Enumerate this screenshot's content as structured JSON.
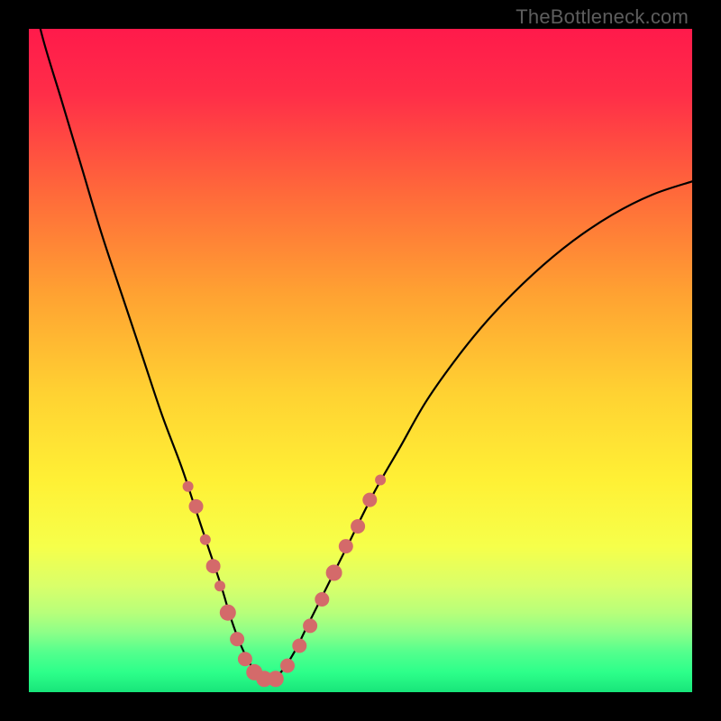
{
  "watermark": {
    "text": "TheBottleneck.com"
  },
  "colors": {
    "frame_bg": "#000000",
    "curve_stroke": "#000000",
    "marker_fill": "#d46a6a",
    "gradient_stops": [
      {
        "offset": 0,
        "color": "#ff1a4b"
      },
      {
        "offset": 10,
        "color": "#ff2e48"
      },
      {
        "offset": 25,
        "color": "#ff6a3a"
      },
      {
        "offset": 40,
        "color": "#ffa232"
      },
      {
        "offset": 55,
        "color": "#ffd232"
      },
      {
        "offset": 68,
        "color": "#fff035"
      },
      {
        "offset": 78,
        "color": "#f6ff4a"
      },
      {
        "offset": 84,
        "color": "#d9ff6a"
      },
      {
        "offset": 88,
        "color": "#b8ff7a"
      },
      {
        "offset": 91,
        "color": "#8dff88"
      },
      {
        "offset": 94,
        "color": "#53ff8d"
      },
      {
        "offset": 97,
        "color": "#2dff8a"
      },
      {
        "offset": 100,
        "color": "#18e57a"
      }
    ]
  },
  "chart_data": {
    "type": "line",
    "title": "",
    "xlabel": "",
    "ylabel": "",
    "xlim": [
      0,
      100
    ],
    "ylim": [
      0,
      100
    ],
    "grid": false,
    "legend": false,
    "series": [
      {
        "name": "v_curve",
        "x": [
          0,
          2,
          5,
          8,
          11,
          14,
          17,
          20,
          23,
          25,
          27,
          29,
          30.5,
          32,
          33.5,
          35,
          36.5,
          38,
          40,
          42,
          45,
          48,
          52,
          56,
          60,
          65,
          70,
          76,
          82,
          88,
          94,
          100
        ],
        "y": [
          108,
          99,
          89,
          79,
          69,
          60,
          51,
          42,
          34,
          28,
          22,
          16,
          11,
          7,
          4,
          2,
          2,
          3,
          6,
          10,
          16,
          22,
          30,
          37,
          44,
          51,
          57,
          63,
          68,
          72,
          75,
          77
        ]
      }
    ],
    "markers": [
      {
        "x": 24.0,
        "y": 31,
        "r": 6
      },
      {
        "x": 25.2,
        "y": 28,
        "r": 8
      },
      {
        "x": 26.6,
        "y": 23,
        "r": 6
      },
      {
        "x": 27.8,
        "y": 19,
        "r": 8
      },
      {
        "x": 28.8,
        "y": 16,
        "r": 6
      },
      {
        "x": 30.0,
        "y": 12,
        "r": 9
      },
      {
        "x": 31.4,
        "y": 8,
        "r": 8
      },
      {
        "x": 32.6,
        "y": 5,
        "r": 8
      },
      {
        "x": 34.0,
        "y": 3,
        "r": 9
      },
      {
        "x": 35.5,
        "y": 2,
        "r": 9
      },
      {
        "x": 37.2,
        "y": 2,
        "r": 9
      },
      {
        "x": 39.0,
        "y": 4,
        "r": 8
      },
      {
        "x": 40.8,
        "y": 7,
        "r": 8
      },
      {
        "x": 42.4,
        "y": 10,
        "r": 8
      },
      {
        "x": 44.2,
        "y": 14,
        "r": 8
      },
      {
        "x": 46.0,
        "y": 18,
        "r": 9
      },
      {
        "x": 47.8,
        "y": 22,
        "r": 8
      },
      {
        "x": 49.6,
        "y": 25,
        "r": 8
      },
      {
        "x": 51.4,
        "y": 29,
        "r": 8
      },
      {
        "x": 53.0,
        "y": 32,
        "r": 6
      }
    ]
  }
}
